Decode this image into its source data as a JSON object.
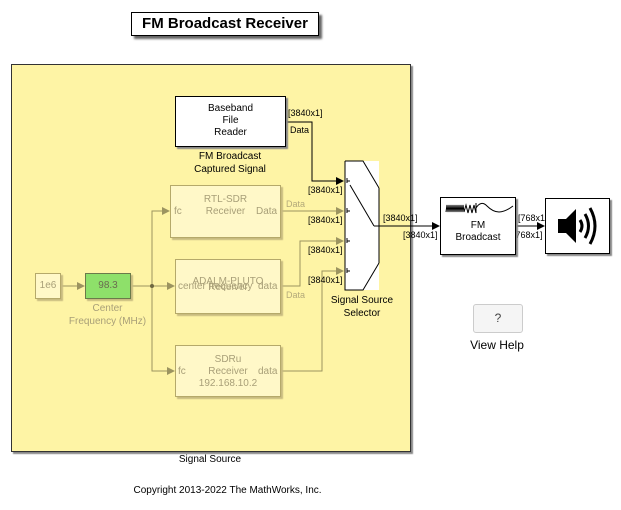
{
  "title": "FM Broadcast Receiver",
  "signal_source": {
    "label": "Signal Source",
    "baseband_block": {
      "lines": [
        "Baseband",
        "File",
        "Reader"
      ],
      "caption": "FM Broadcast\nCaptured Signal",
      "out_port": "Data"
    },
    "rtl_block": {
      "lines": [
        "RTL-SDR",
        "Receiver"
      ],
      "in_port": "fc",
      "out_port": "Data",
      "signal_label": "Data"
    },
    "pluto_block": {
      "lines": [
        "ADALM-PLUTO",
        "Receiver"
      ],
      "in_port": "center frequency",
      "out_port": "data",
      "signal_label": "Data"
    },
    "sdru_block": {
      "lines": [
        "SDRu",
        "Receiver",
        "192.168.10.2"
      ],
      "in_port": "fc",
      "out_port": "data"
    },
    "gain_block": {
      "value": "1e6"
    },
    "freq_block": {
      "value": "98.3",
      "caption": "Center\nFrequency (MHz)",
      "color": "#8ee06a"
    },
    "selector": {
      "caption": "Signal Source\nSelector"
    }
  },
  "fm_block": {
    "lines": [
      "FM",
      "Broadcast"
    ]
  },
  "audio_block": {
    "icon": "speaker-icon"
  },
  "signal_dims": {
    "baseband_out": "[3840x1]",
    "sel_in1": "[3840x1]",
    "sel_in2": "[3840x1]",
    "sel_in3": "[3840x1]",
    "sel_in4": "[3840x1]",
    "sel_out_top": "[3840x1]",
    "sel_out_bottom": "[3840x1]",
    "fm_out_top": "[768x1]",
    "fm_out_bottom": "[768x1]"
  },
  "help": {
    "button_label": "?",
    "caption": "View Help"
  },
  "copyright": "Copyright 2013-2022 The MathWorks, Inc."
}
